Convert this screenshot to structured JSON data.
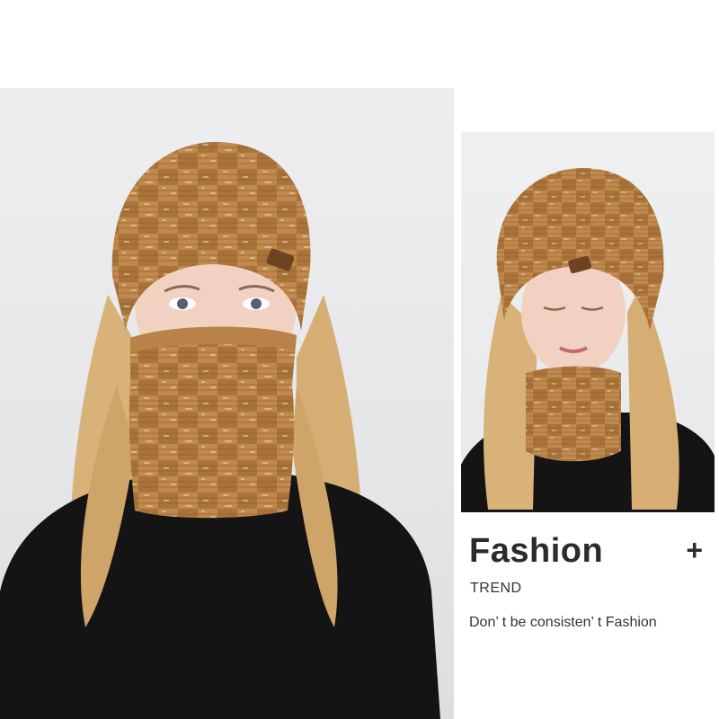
{
  "caption": {
    "headline": "Fashion",
    "plus": "+",
    "subheading": "TREND",
    "tagline": "Don’ t be consisten’ t Fashion"
  },
  "colors": {
    "knit": "#a9733a",
    "knit_dark": "#7d4f22",
    "knit_light": "#d4a872",
    "hair": "#d9b27a",
    "sweater": "#141414",
    "skin": "#f1d2c2",
    "background": "#e6e8ea"
  },
  "images": {
    "main": "woman-wearing-knit-beanie-and-scarf-pulled-over-face",
    "side": "woman-wearing-knit-beanie-and-neck-scarf-looking-down"
  }
}
